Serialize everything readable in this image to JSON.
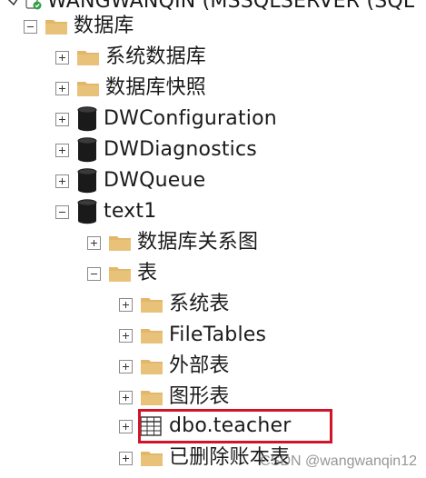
{
  "server_node": {
    "label": "WANGWANQIN (MSSQLSERVER (SQL"
  },
  "tree": {
    "root": {
      "label": "数据库",
      "expanded": true
    },
    "items": [
      {
        "label": "系统数据库",
        "type": "folder",
        "expanded": false
      },
      {
        "label": "数据库快照",
        "type": "folder",
        "expanded": false
      },
      {
        "label": "DWConfiguration",
        "type": "database",
        "expanded": false
      },
      {
        "label": "DWDiagnostics",
        "type": "database",
        "expanded": false
      },
      {
        "label": "DWQueue",
        "type": "database",
        "expanded": false
      },
      {
        "label": "text1",
        "type": "database",
        "expanded": true
      }
    ],
    "text1_children": [
      {
        "label": "数据库关系图",
        "type": "folder",
        "expanded": false
      },
      {
        "label": "表",
        "type": "folder",
        "expanded": true
      }
    ],
    "tables_children": [
      {
        "label": "系统表",
        "type": "folder",
        "expanded": false
      },
      {
        "label": "FileTables",
        "type": "folder",
        "expanded": false
      },
      {
        "label": "外部表",
        "type": "folder",
        "expanded": false
      },
      {
        "label": "图形表",
        "type": "folder",
        "expanded": false
      },
      {
        "label": "dbo.teacher",
        "type": "table",
        "expanded": false,
        "highlighted": true
      },
      {
        "label": "已删除账本表",
        "type": "folder",
        "expanded": false
      }
    ]
  },
  "watermark": "CSDN @wangwanqin12",
  "colors": {
    "folder": "#e2b76b",
    "highlight": "#d0152a",
    "server_icon": "#2ea043"
  }
}
